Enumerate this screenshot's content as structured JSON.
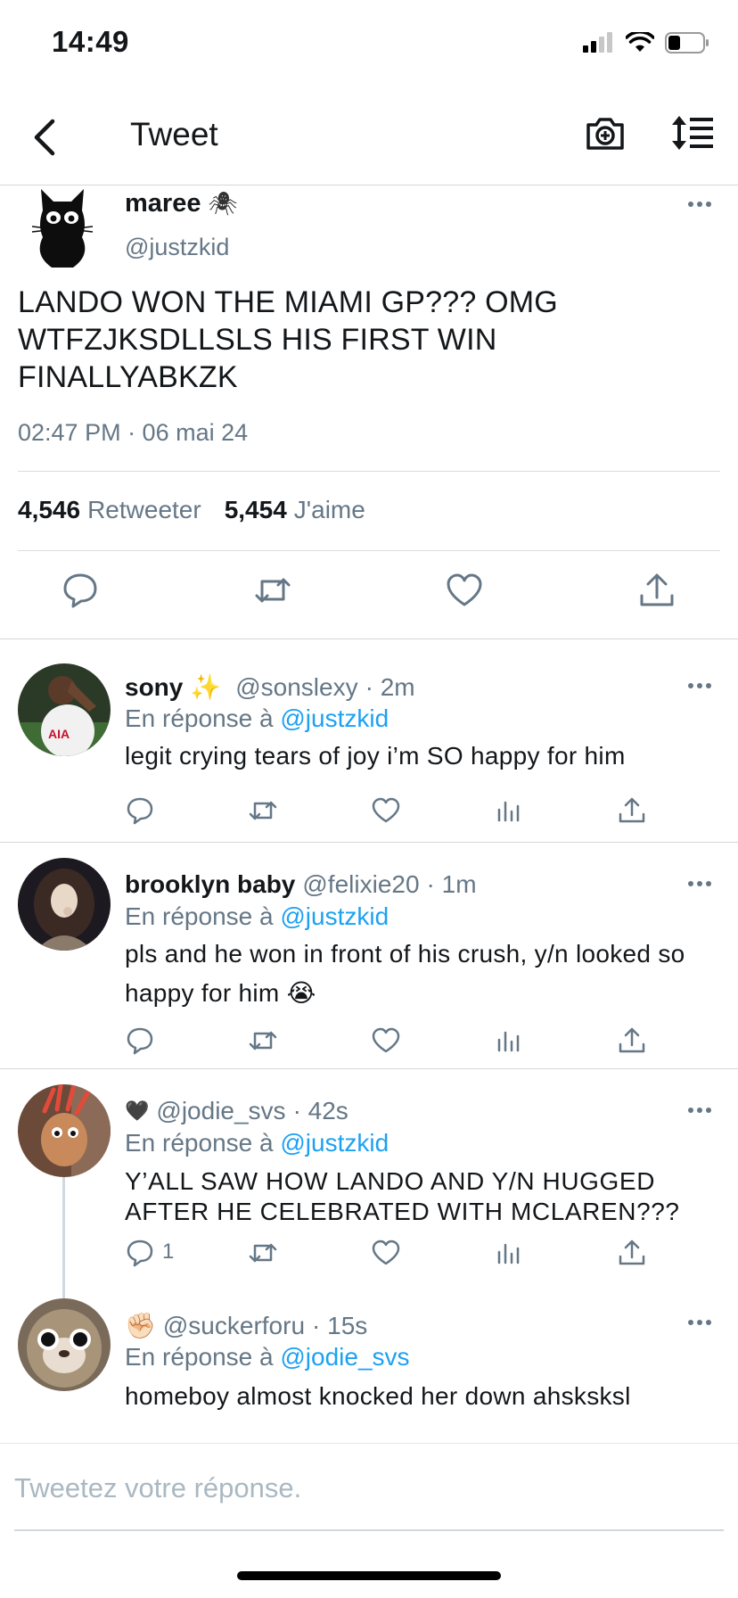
{
  "status_bar": {
    "time": "14:49"
  },
  "nav": {
    "title": "Tweet"
  },
  "main_tweet": {
    "name": "maree",
    "name_emoji": "🕷",
    "handle": "@justzkid",
    "text": "LANDO WON THE MIAMI GP??? OMG WTFZJKSDLLSLS HIS FIRST WIN FINALLYABKZK",
    "timestamp": "02:47 PM · 06 mai 24",
    "retweets_count": "4,546",
    "retweets_label": "Retweeter",
    "likes_count": "5,454",
    "likes_label": "J'aime"
  },
  "replies": [
    {
      "name": "sony",
      "name_emoji": "✨",
      "handle": "@sonslexy",
      "time": "· 2m",
      "reply_prefix": "En réponse à",
      "reply_to": "@justzkid",
      "text": "legit crying tears of joy i’m SO happy for him",
      "reply_count": ""
    },
    {
      "name": "brooklyn baby",
      "handle": "@felixie20",
      "time": "· 1m",
      "reply_prefix": "En réponse à",
      "reply_to": "@justzkid",
      "text": "pls and he won in front of his crush, y/n looked so happy for him 😭",
      "reply_count": ""
    },
    {
      "name": "🖤",
      "handle": "@jodie_svs",
      "time": "· 42s",
      "reply_prefix": "En réponse à",
      "reply_to": "@justzkid",
      "text": "Y’ALL SAW HOW LANDO AND Y/N HUGGED AFTER HE CELEBRATED WITH MCLAREN???",
      "reply_count": "1"
    },
    {
      "name": "✊🏻",
      "handle": "@suckerforu",
      "time": "· 15s",
      "reply_prefix": "En réponse à",
      "reply_to": "@jodie_svs",
      "text": "homeboy almost knocked her down ahsksksl",
      "reply_count": ""
    }
  ],
  "composer": {
    "placeholder": "Tweetez votre réponse."
  },
  "colors": {
    "link": "#1da1f2",
    "secondary_text": "#657786",
    "icon": "#657786"
  },
  "icons": [
    "back-icon",
    "camera-icon",
    "sort-icon",
    "reply-icon",
    "retweet-icon",
    "like-icon",
    "analytics-icon",
    "share-icon",
    "more-icon",
    "signal-icon",
    "wifi-icon",
    "battery-icon"
  ]
}
